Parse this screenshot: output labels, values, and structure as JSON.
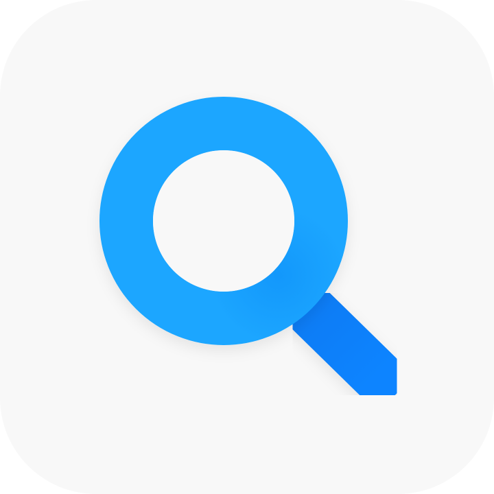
{
  "app_icon": {
    "icon": "magnifying-glass-icon",
    "colors": {
      "background": "#f8f8f8",
      "ring": "#1aa6ff",
      "handle_start": "#0a7cf5",
      "handle_end": "#0a84ff",
      "lens": "#f8f8f8"
    }
  }
}
